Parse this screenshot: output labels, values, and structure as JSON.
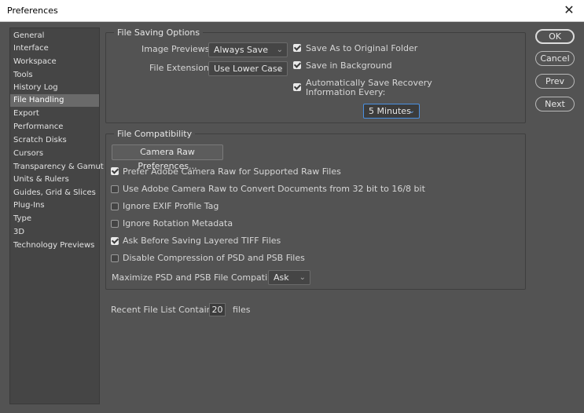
{
  "window": {
    "title": "Preferences",
    "close_glyph": "✕"
  },
  "sidebar": {
    "items": [
      {
        "label": "General"
      },
      {
        "label": "Interface"
      },
      {
        "label": "Workspace"
      },
      {
        "label": "Tools"
      },
      {
        "label": "History Log"
      },
      {
        "label": "File Handling"
      },
      {
        "label": "Export"
      },
      {
        "label": "Performance"
      },
      {
        "label": "Scratch Disks"
      },
      {
        "label": "Cursors"
      },
      {
        "label": "Transparency & Gamut"
      },
      {
        "label": "Units & Rulers"
      },
      {
        "label": "Guides, Grid & Slices"
      },
      {
        "label": "Plug-Ins"
      },
      {
        "label": "Type"
      },
      {
        "label": "3D"
      },
      {
        "label": "Technology Previews"
      }
    ],
    "active_index": 5
  },
  "saving": {
    "title": "File Saving Options",
    "image_previews_label": "Image Previews:",
    "image_previews_value": "Always Save",
    "file_extension_label": "File Extension:",
    "file_extension_value": "Use Lower Case",
    "save_as_original": "Save As to Original Folder",
    "save_in_background": "Save in Background",
    "auto_save_line1": "Automatically Save Recovery",
    "auto_save_line2": "Information Every:",
    "auto_save_interval": "5 Minutes"
  },
  "compat": {
    "title": "File Compatibility",
    "camera_raw_button": "Camera Raw Preferences...",
    "options": [
      {
        "label": "Prefer Adobe Camera Raw for Supported Raw Files",
        "checked": true
      },
      {
        "label": "Use Adobe Camera Raw to Convert Documents from 32 bit to 16/8 bit",
        "checked": false
      },
      {
        "label": "Ignore EXIF Profile Tag",
        "checked": false
      },
      {
        "label": "Ignore Rotation Metadata",
        "checked": false
      },
      {
        "label": "Ask Before Saving Layered TIFF Files",
        "checked": true
      },
      {
        "label": "Disable Compression of PSD and PSB Files",
        "checked": false
      }
    ],
    "maximize_label": "Maximize PSD and PSB File Compatibility:",
    "maximize_value": "Ask"
  },
  "recent": {
    "label": "Recent File List Contains:",
    "value": "20",
    "suffix": "files"
  },
  "buttons": {
    "ok": "OK",
    "cancel": "Cancel",
    "prev": "Prev",
    "next": "Next"
  },
  "icons": {
    "chevron": "⌄"
  }
}
